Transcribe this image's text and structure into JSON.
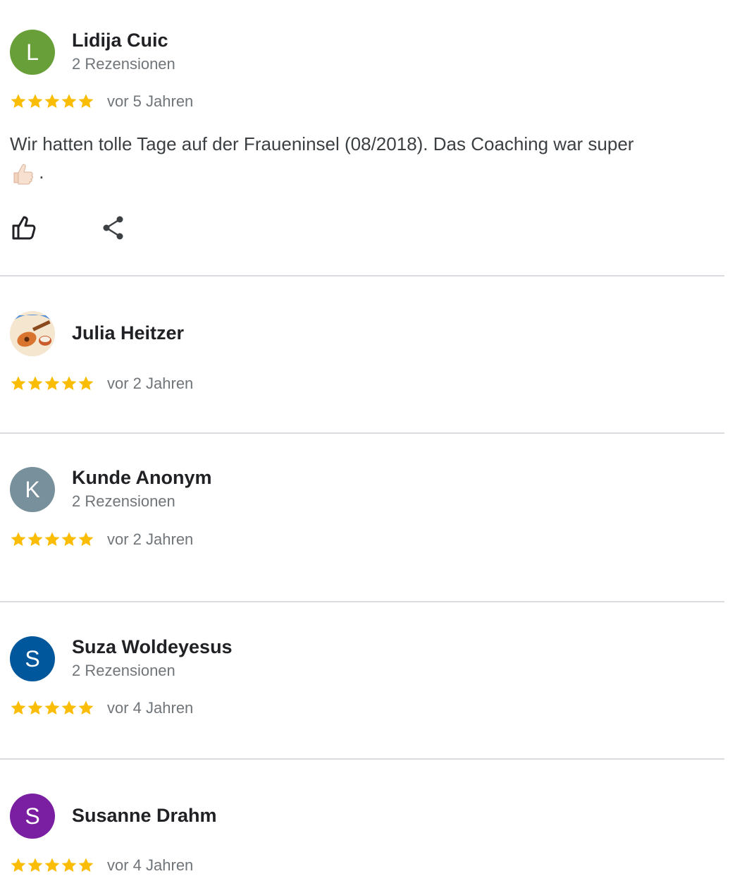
{
  "colors": {
    "star": "#fbbc04",
    "avatar_l": "#689f38",
    "avatar_k": "#78909c",
    "avatar_suza": "#01579b",
    "avatar_susanne": "#7b1fa2",
    "muted_text": "#70757a",
    "divider": "#dadce0"
  },
  "reviews": [
    {
      "name": "Lidija Cuic",
      "initial": "L",
      "review_count": "2 Rezensionen",
      "stars": 5,
      "date": "vor 5 Jahren",
      "text": "Wir hatten tolle Tage auf der Fraueninsel (08/2018). Das Coaching war super",
      "text_suffix": ".",
      "emoji": "thumbs-up-emoji",
      "actions": [
        "like-icon",
        "share-icon"
      ]
    },
    {
      "name": "Julia Heitzer",
      "avatar_image": "ukulele-photo",
      "stars": 5,
      "date": "vor 2 Jahren"
    },
    {
      "name": "Kunde Anonym",
      "initial": "K",
      "review_count": "2 Rezensionen",
      "stars": 5,
      "date": "vor 2 Jahren"
    },
    {
      "name": "Suza Woldeyesus",
      "initial": "S",
      "review_count": "2 Rezensionen",
      "stars": 5,
      "date": "vor 4 Jahren"
    },
    {
      "name": "Susanne Drahm",
      "initial": "S",
      "stars": 5,
      "date": "vor 4 Jahren"
    }
  ]
}
